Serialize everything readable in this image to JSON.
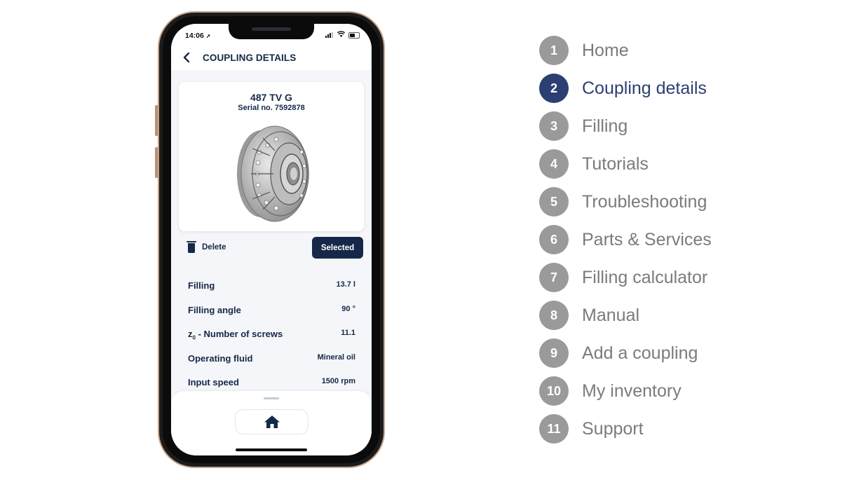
{
  "status_bar": {
    "time": "14:06",
    "location_icon": "location-arrow-icon",
    "signal_icon": "cellular-signal-icon",
    "wifi_icon": "wifi-icon",
    "battery_icon": "battery-icon"
  },
  "header": {
    "back_icon": "chevron-left-icon",
    "title": "COUPLING DETAILS"
  },
  "card": {
    "model": "487 TV G",
    "serial": "Serial no. 7592878",
    "image": "fluid-coupling-3d-render"
  },
  "actions": {
    "delete_label": "Delete",
    "delete_icon": "trash-icon",
    "selected_label": "Selected"
  },
  "properties": [
    {
      "label": "Filling",
      "value": "13.7 l"
    },
    {
      "label": "Filling angle",
      "value": "90 °"
    },
    {
      "label_main": "z",
      "label_sub": "0",
      "label_rest": " - Number of screws",
      "value": "11.1"
    },
    {
      "label": "Operating fluid",
      "value": "Mineral oil"
    },
    {
      "label": "Input speed",
      "value": "1500 rpm"
    }
  ],
  "bottom_bar": {
    "home_icon": "home-icon"
  },
  "legend": {
    "active_color": "#2b3f72",
    "inactive_color": "#9a9a9a",
    "items": [
      {
        "number": "1",
        "label": "Home",
        "active": false
      },
      {
        "number": "2",
        "label": "Coupling details",
        "active": true
      },
      {
        "number": "3",
        "label": "Filling",
        "active": false
      },
      {
        "number": "4",
        "label": "Tutorials",
        "active": false
      },
      {
        "number": "5",
        "label": "Troubleshooting",
        "active": false
      },
      {
        "number": "6",
        "label": "Parts & Services",
        "active": false
      },
      {
        "number": "7",
        "label": "Filling calculator",
        "active": false
      },
      {
        "number": "8",
        "label": "Manual",
        "active": false
      },
      {
        "number": "9",
        "label": "Add a coupling",
        "active": false
      },
      {
        "number": "10",
        "label": "My inventory",
        "active": false
      },
      {
        "number": "11",
        "label": "Support",
        "active": false
      }
    ]
  }
}
